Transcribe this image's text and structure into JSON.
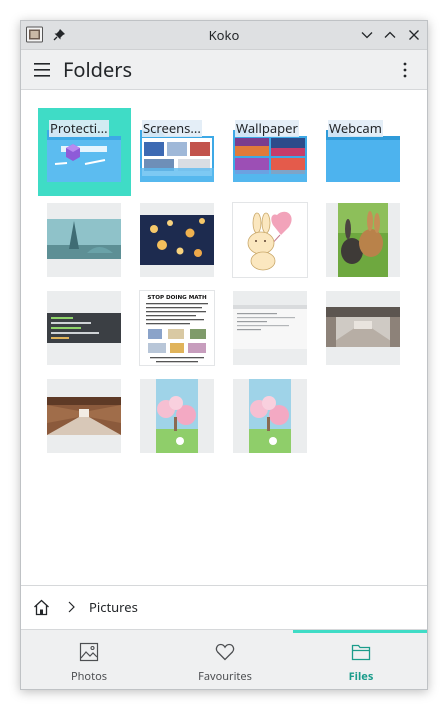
{
  "window": {
    "title": "Koko"
  },
  "header": {
    "title": "Folders"
  },
  "folders": [
    {
      "label": "Protecti..."
    },
    {
      "label": "Screens..."
    },
    {
      "label": "Wallpaper"
    },
    {
      "label": "Webcam"
    }
  ],
  "photos": {
    "meme_caption": "STOP DOING MATH"
  },
  "breadcrumb": {
    "items": [
      "Pictures"
    ]
  },
  "bottom_nav": {
    "tabs": [
      {
        "label": "Photos"
      },
      {
        "label": "Favourites"
      },
      {
        "label": "Files"
      }
    ]
  },
  "colors": {
    "accent": "#3fdcc6",
    "folder_blue": "#3da9e6"
  }
}
